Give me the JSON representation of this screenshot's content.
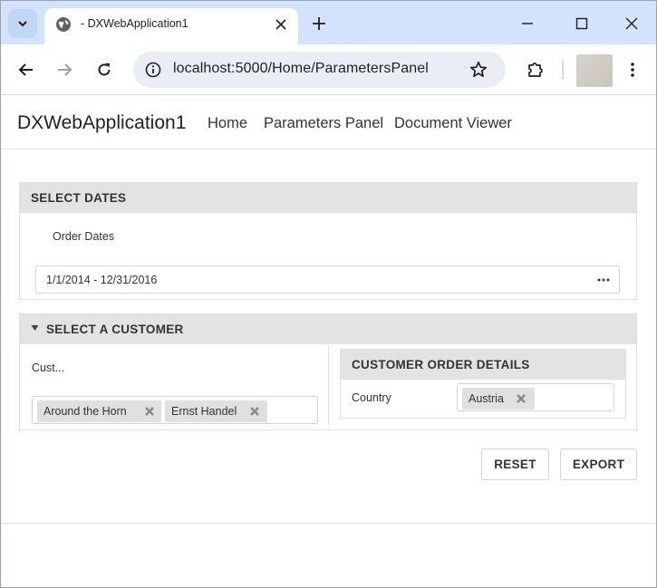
{
  "browser": {
    "tab_title": "- DXWebApplication1",
    "url": "localhost:5000/Home/ParametersPanel"
  },
  "nav": {
    "brand": "DXWebApplication1",
    "links": [
      "Home",
      "Parameters Panel",
      "Document Viewer"
    ]
  },
  "select_dates": {
    "header": "SELECT DATES",
    "label": "Order Dates",
    "value": "1/1/2014 - 12/31/2016"
  },
  "select_customer": {
    "header": "SELECT A CUSTOMER",
    "label": "Cust...",
    "tags": [
      "Around the Horn",
      "Ernst Handel"
    ]
  },
  "customer_order_details": {
    "header": "CUSTOMER ORDER DETAILS",
    "label": "Country",
    "tags": [
      "Austria"
    ]
  },
  "buttons": {
    "reset": "RESET",
    "export": "EXPORT"
  },
  "icons": {
    "tab_search": "chevron-down-icon",
    "favicon": "globe-icon",
    "tab_close": "close-icon",
    "new_tab": "plus-icon",
    "back": "arrow-left-icon",
    "forward": "arrow-right-icon",
    "reload": "reload-icon",
    "site_info": "info-icon",
    "bookmark": "star-icon",
    "extensions": "puzzle-icon",
    "menu": "kebab-menu-icon",
    "collapse": "triangle-down-icon",
    "ellipsis": "ellipsis-icon",
    "tag_remove": "remove-x-icon"
  },
  "colors": {
    "tabstrip": "#d3e3fd",
    "omnibox": "#e9eef6",
    "group_header": "#e3e3e3",
    "tag": "#e0e0e0"
  }
}
